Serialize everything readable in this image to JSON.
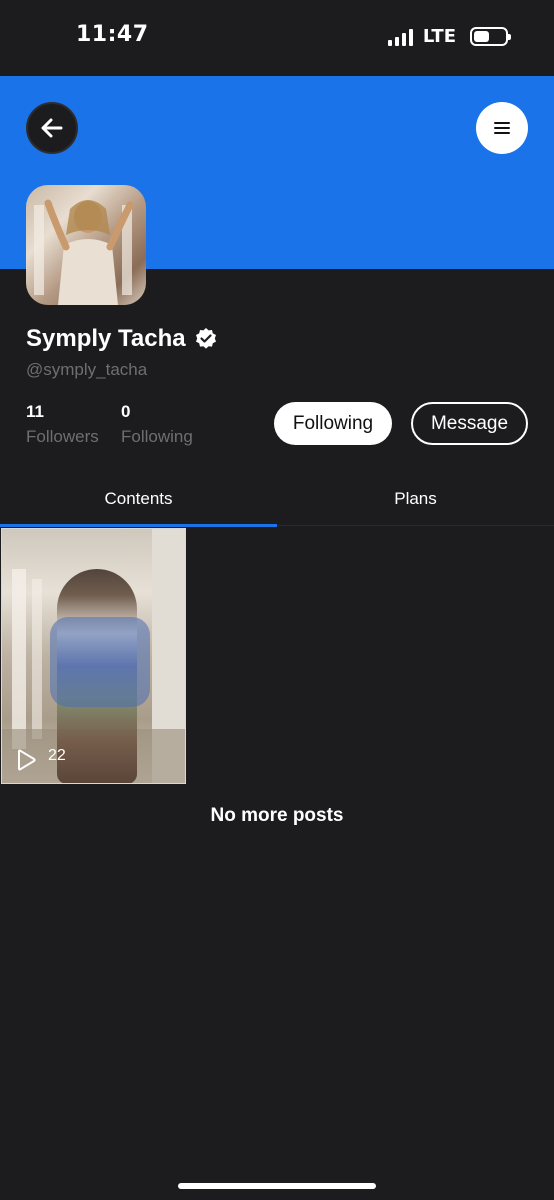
{
  "status_bar": {
    "time": "11:47",
    "network": "LTE",
    "battery_level": 0.5
  },
  "header": {
    "back_icon": "arrow-left-icon",
    "menu_icon": "hamburger-menu-icon",
    "accent_color": "#1a73e8"
  },
  "profile": {
    "name": "Symply Tacha",
    "handle": "@symply_tacha",
    "verified": true,
    "verified_icon": "verified-badge-icon",
    "stats": {
      "followers_count": "11",
      "followers_label": "Followers",
      "following_count": "0",
      "following_label": "Following"
    },
    "actions": {
      "following_label": "Following",
      "message_label": "Message"
    }
  },
  "tabs": [
    {
      "label": "Contents",
      "active": true
    },
    {
      "label": "Plans",
      "active": false
    }
  ],
  "posts": [
    {
      "play_icon": "play-icon",
      "views": "22"
    }
  ],
  "footer": {
    "no_more_text": "No more posts"
  }
}
